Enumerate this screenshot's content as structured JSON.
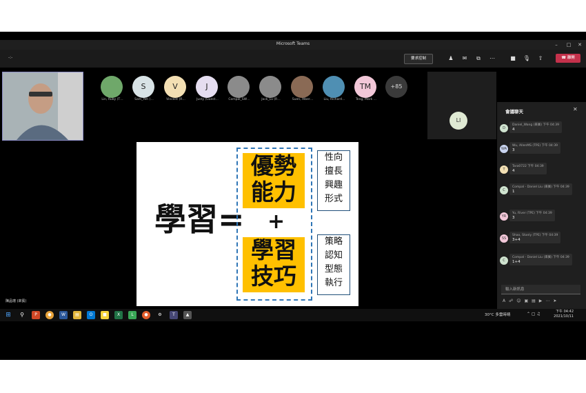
{
  "window": {
    "title": "Microsoft Teams"
  },
  "toolbar": {
    "timer": "-:-",
    "request_control": "要求控制",
    "leave": "離開"
  },
  "participants": [
    {
      "name": "Lin, Ruby (T…",
      "initials": "",
      "color": "#6fa86a"
    },
    {
      "name": "Sam_Yeh (…",
      "initials": "S",
      "color": "#d8e3e6"
    },
    {
      "name": "Vincent (R…",
      "initials": "V",
      "color": "#f3dfb3"
    },
    {
      "name": "Justy (Guest…",
      "initials": "J",
      "color": "#e5ddf0"
    },
    {
      "name": "Compal_SW…",
      "initials": "",
      "color": "#8b8b8b"
    },
    {
      "name": "Jack_Lu (R…",
      "initials": "",
      "color": "#8b8b8b"
    },
    {
      "name": "Suen, Alber…",
      "initials": "",
      "color": "#8a6a55"
    },
    {
      "name": "Liu, Richard…",
      "initials": "",
      "color": "#4f8fb3"
    },
    {
      "name": "Teng, Mark …",
      "initials": "TM",
      "color": "#f2c7d8"
    }
  ],
  "more_count": "+85",
  "li_tile": {
    "initials": "LI"
  },
  "presenter_name": "陳品璁 (來賓)",
  "slide": {
    "left_text": "學習=",
    "plus": "+",
    "top_box": [
      "優勢",
      "能力"
    ],
    "bottom_box": [
      "學習",
      "技巧"
    ],
    "top_side": [
      "性向",
      "擅長",
      "興趣",
      "形式"
    ],
    "bottom_side": [
      "策略",
      "認知",
      "型態",
      "執行"
    ]
  },
  "chat": {
    "title": "會議聊天",
    "messages": [
      {
        "avatar": "D",
        "avatar_color": "#cfe3cf",
        "sender": "Daniel_Wang (來賓)",
        "time": "下午 04:39",
        "text": "4"
      },
      {
        "avatar": "WA",
        "avatar_color": "#c9d4f0",
        "sender": "Wu, AllenMS (TPE)",
        "time": "下午 04:39",
        "text": "3"
      },
      {
        "avatar": "T",
        "avatar_color": "#f3dfb3",
        "sender": "Tara0722",
        "time": "下午 04:39",
        "text": "4"
      },
      {
        "avatar": "C",
        "avatar_color": "#cfe3cf",
        "sender": "Compal - Daniel Liu (來賓)",
        "time": "下午 04:39",
        "text": "1"
      },
      {
        "avatar": "YR",
        "avatar_color": "#f2c7d8",
        "sender": "Yu, River (TPE)",
        "time": "下午 04:39",
        "text": "3"
      },
      {
        "avatar": "SS",
        "avatar_color": "#f2c7d8",
        "sender": "Shao, Stanly (TPE)",
        "time": "下午 04:39",
        "text": "3+4"
      },
      {
        "avatar": "C",
        "avatar_color": "#cfe3cf",
        "sender": "Compal - Daniel Liu (來賓)",
        "time": "下午 04:39",
        "text": "1+4"
      }
    ],
    "input_placeholder": "輸入新訊息"
  },
  "taskbar": {
    "weather": "30°C 多雲時晴",
    "time": "下午 04:42",
    "date": "2021/10/11"
  }
}
